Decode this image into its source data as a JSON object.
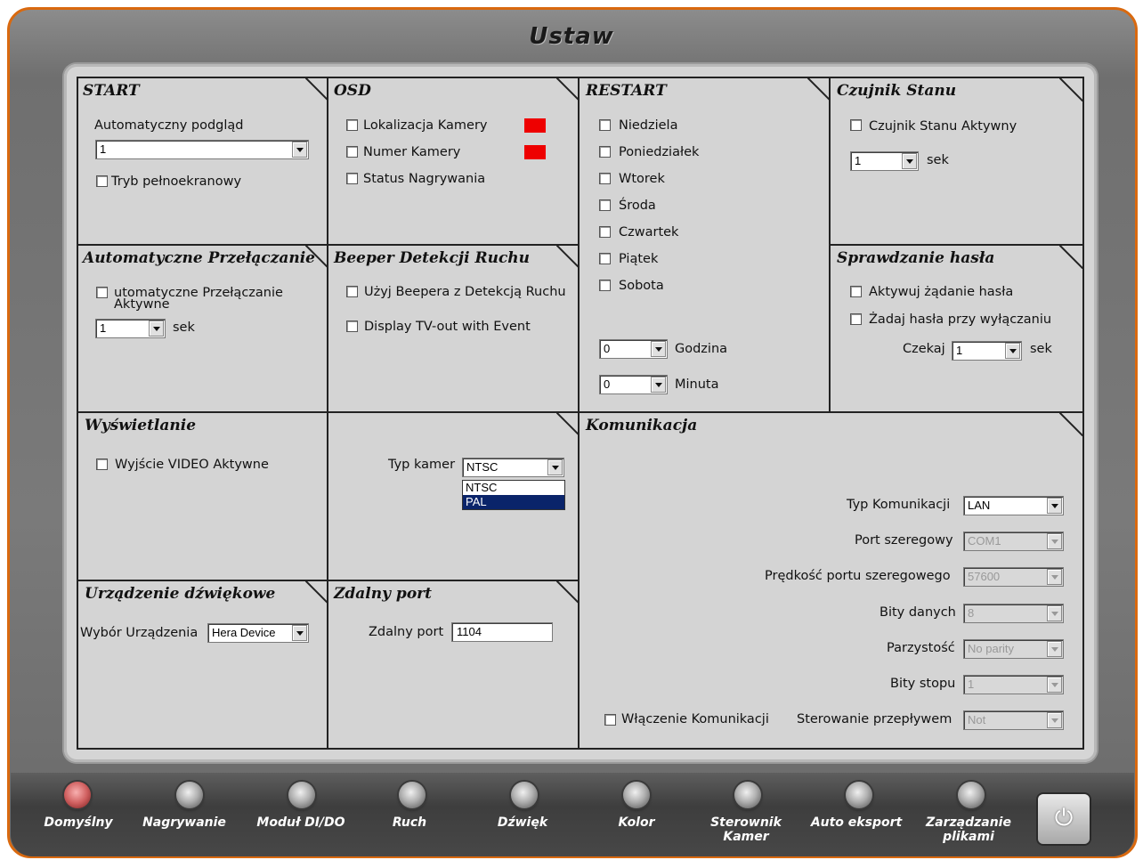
{
  "window": {
    "title": "Ustaw"
  },
  "start": {
    "title": "START",
    "auto_preview_label": "Automatyczny podgląd",
    "auto_preview_value": "1",
    "fullscreen_label": "Tryb pełnoekranowy"
  },
  "osd": {
    "title": "OSD",
    "items": [
      "Lokalizacja Kamery",
      "Numer Kamery",
      "Status Nagrywania"
    ],
    "swatch_color": "#ee0000"
  },
  "restart": {
    "title": "RESTART",
    "days": [
      "Niedziela",
      "Poniedziałek",
      "Wtorek",
      "Środa",
      "Czwartek",
      "Piątek",
      "Sobota"
    ],
    "hour_value": "0",
    "hour_label": "Godzina",
    "minute_value": "0",
    "minute_label": "Minuta"
  },
  "sensor": {
    "title": "Czujnik Stanu",
    "active_label": "Czujnik Stanu Aktywny",
    "value": "1",
    "unit": "sek"
  },
  "autoswitch": {
    "title": "Automatyczne Przełączanie",
    "active_line1": "utomatyczne Przełączanie",
    "active_line2": "Aktywne",
    "value": "1",
    "unit": "sek"
  },
  "beeper": {
    "title": "Beeper Detekcji Ruchu",
    "use_label": "Użyj Beepera z Detekcją Ruchu",
    "tvout_label": "Display TV-out with Event"
  },
  "password": {
    "title": "Sprawdzanie hasła",
    "activate_label": "Aktywuj żądanie hasła",
    "on_shutdown_label": "Żadaj hasła przy wyłączaniu",
    "wait_label": "Czekaj",
    "wait_value": "1",
    "unit": "sek"
  },
  "display": {
    "title": "Wyświetlanie",
    "video_out_label": "Wyjście VIDEO Aktywne",
    "camera_type_label": "Typ kamer",
    "camera_type_value": "NTSC",
    "camera_type_options": [
      "NTSC",
      "PAL"
    ]
  },
  "communication": {
    "title": "Komunikacja",
    "type_label": "Typ Komunikacji",
    "type_value": "LAN",
    "serial_port_label": "Port szeregowy",
    "serial_port_value": "COM1",
    "baud_label": "Prędkość portu szeregowego",
    "baud_value": "57600",
    "data_bits_label": "Bity danych",
    "data_bits_value": "8",
    "parity_label": "Parzystość",
    "parity_value": "No parity",
    "stop_bits_label": "Bity stopu",
    "stop_bits_value": "1",
    "flow_label": "Sterowanie przepływem",
    "flow_value": "Not",
    "enable_label": "Włączenie Komunikacji"
  },
  "audio": {
    "title": "Urządzenie dźwiękowe",
    "device_label": "Wybór Urządzenia",
    "device_value": "Hera Device"
  },
  "remote": {
    "title": "Zdalny port",
    "port_label": "Zdalny port",
    "port_value": "1104"
  },
  "nav": {
    "items": [
      "Domyślny",
      "Nagrywanie",
      "Moduł DI/DO",
      "Ruch",
      "Dźwięk",
      "Kolor",
      "Sterownik Kamer",
      "Auto eksport",
      "Zarządzanie plikami"
    ],
    "power_icon": "power-icon",
    "accent": "#d9690f"
  }
}
